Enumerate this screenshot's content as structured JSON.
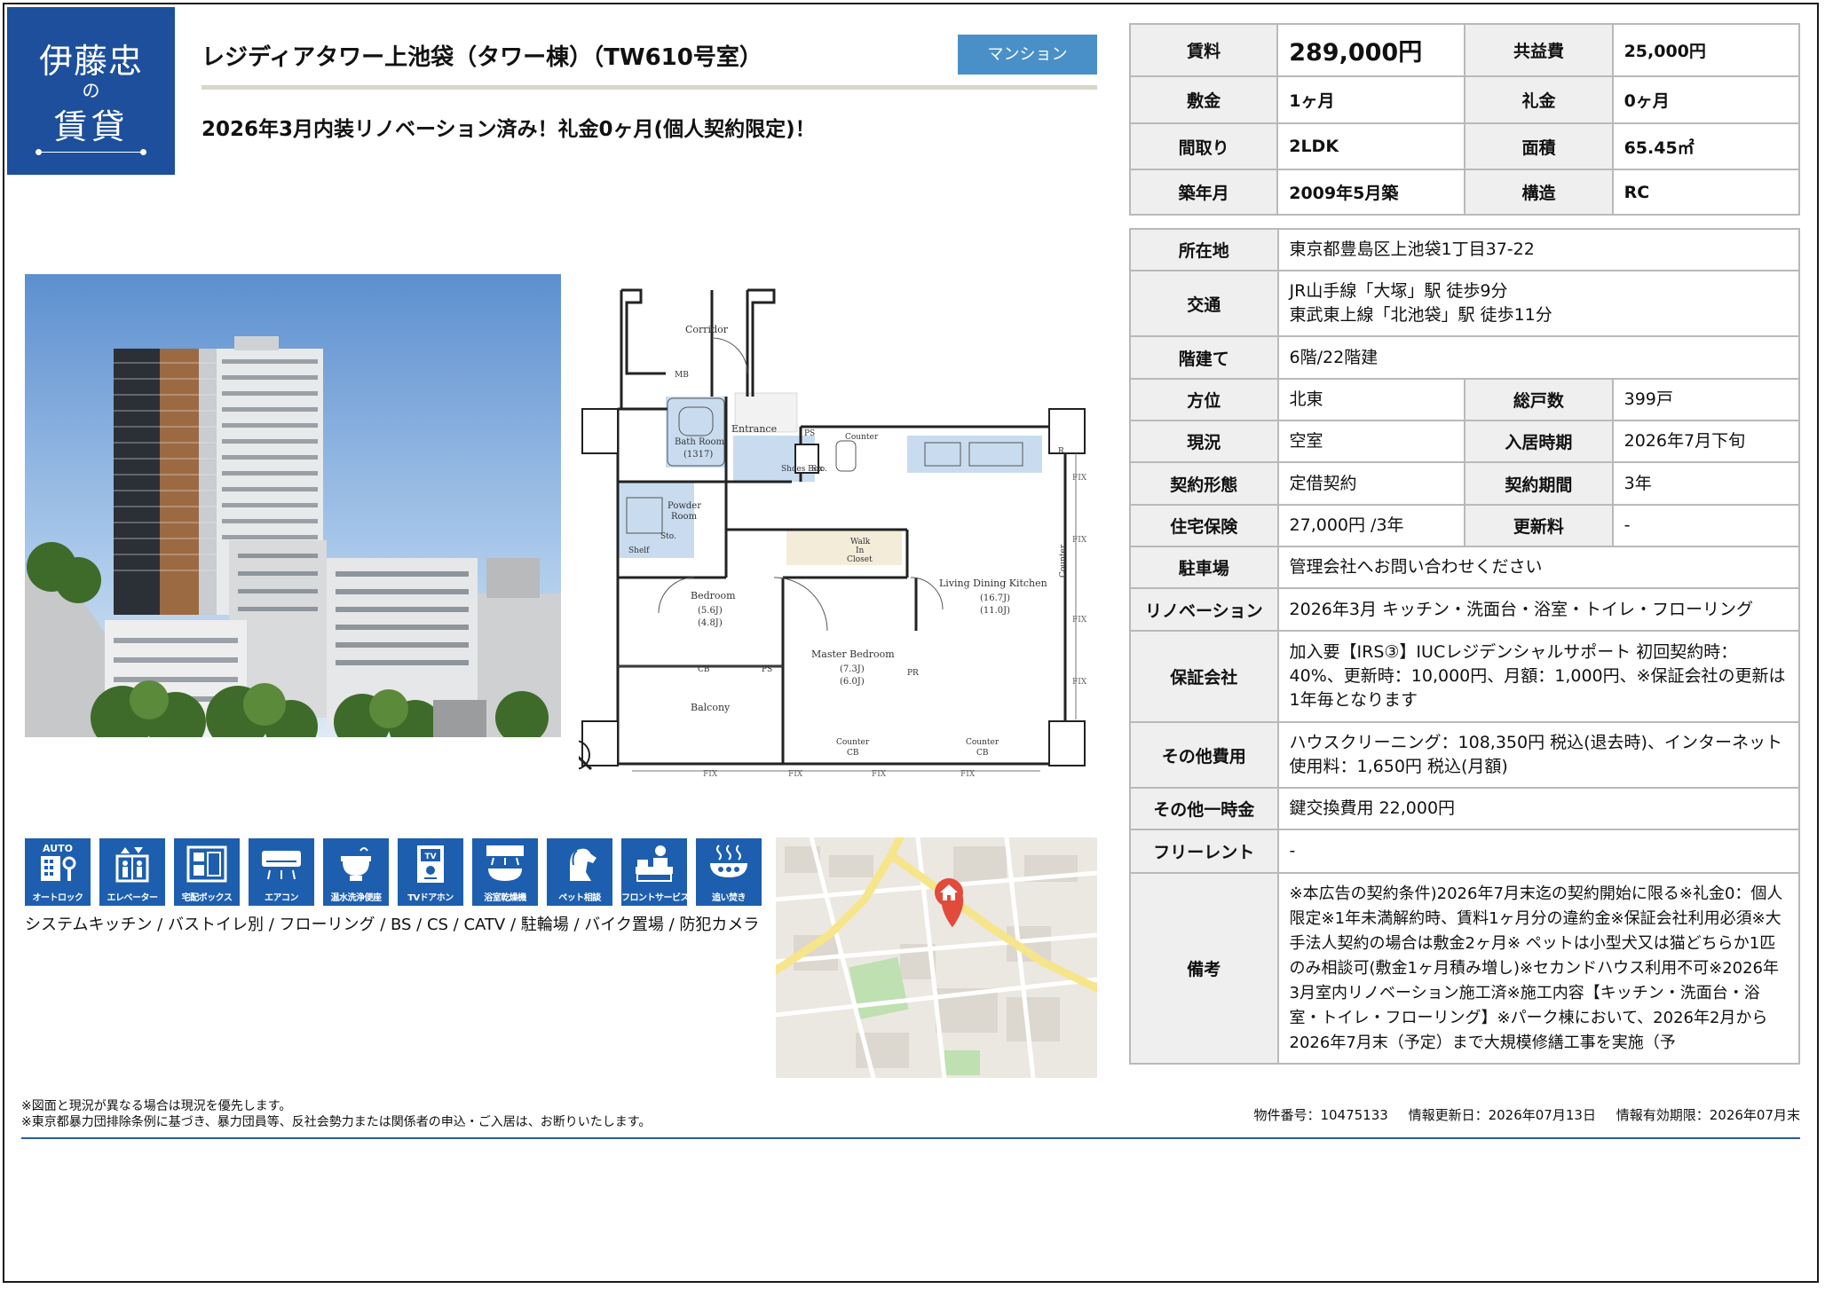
{
  "logo": {
    "line1": "伊藤忠",
    "line2": "の",
    "line3": "賃貸"
  },
  "title": "レジディアタワー上池袋（タワー棟）（TW610号室）",
  "badge": "マンション",
  "subtitle": "2026年3月内装リノベーション済み！礼金0ヶ月(個人契約限定)！",
  "top_table": [
    [
      "賃料",
      "289,000円",
      "共益費",
      "25,000円"
    ],
    [
      "敷金",
      "1ヶ月",
      "礼金",
      "0ヶ月"
    ],
    [
      "間取り",
      "2LDK",
      "面積",
      "65.45㎡"
    ],
    [
      "築年月",
      "2009年5月築",
      "構造",
      "RC"
    ]
  ],
  "details": {
    "address_label": "所在地",
    "address": "東京都豊島区上池袋1丁目37-22",
    "transit_label": "交通",
    "transit_1": "JR山手線「大塚」駅 徒歩9分",
    "transit_2": "東武東上線「北池袋」駅 徒歩11分",
    "floor_label": "階建て",
    "floor": "6階/22階建",
    "direction_label": "方位",
    "direction": "北東",
    "units_label": "総戸数",
    "units": "399戸",
    "status_label": "現況",
    "status": "空室",
    "movein_label": "入居時期",
    "movein": "2026年7月下旬",
    "contract_label": "契約形態",
    "contract": "定借契約",
    "term_label": "契約期間",
    "term": "3年",
    "insurance_label": "住宅保険",
    "insurance": "27,000円 /3年",
    "renewal_label": "更新料",
    "renewal": "-",
    "parking_label": "駐車場",
    "parking": "管理会社へお問い合わせください",
    "renovation_label": "リノベーション",
    "renovation": "2026年3月 キッチン・洗面台・浴室・トイレ・フローリング",
    "guarantor_label": "保証会社",
    "guarantor": "加入要【IRS③】IUCレジデンシャルサポート 初回契約時：40%、更新時：10,000円、月額：1,000円、※保証会社の更新は1年毎となります",
    "other_fee_label": "その他費用",
    "other_fee": "ハウスクリーニング：108,350円 税込(退去時)、インターネット使用料：1,650円 税込(月額)",
    "onetime_label": "その他一時金",
    "onetime": "鍵交換費用 22,000円",
    "freerent_label": "フリーレント",
    "freerent": "-",
    "notes_label": "備考",
    "notes": "※本広告の契約条件)2026年7月末迄の契約開始に限る※礼金0：個人限定※1年未満解約時、賃料1ヶ月分の違約金※保証会社利用必須※大手法人契約の場合は敷金2ヶ月※ ペットは小型犬又は猫どちらか1匹のみ相談可(敷金1ヶ月積み増し)※セカンドハウス利用不可※2026年3月室内リノベーション施工済※施工内容【キッチン・洗面台・浴室・トイレ・フローリング】※パーク棟において、2026年2月から2026年7月末（予定）まで大規模修繕工事を実施（予"
  },
  "floorplan": {
    "corridor": "Corridor",
    "mb": "MB",
    "entrance": "Entrance",
    "bath": "Bath Room",
    "bath_size": "(1317)",
    "counter_top": "Counter",
    "powder": "Powder",
    "powder2": "Room",
    "shelf": "Shelf",
    "sto": "Sto.",
    "shoes": "Shoes Box",
    "ps": "PS",
    "closet1": "Walk",
    "closet2": "In",
    "closet3": "Closet",
    "bedroom": "Bedroom",
    "bedroom_j1": "(5.6J)",
    "bedroom_j2": "(4.8J)",
    "ldk": "Living Dining Kitchen",
    "ldk_j1": "(16.7J)",
    "ldk_j2": "(11.0J)",
    "master": "Master Bedroom",
    "master_j1": "(7.3J)",
    "master_j2": "(6.0J)",
    "balcony": "Balcony",
    "counter_b1": "Counter",
    "counter_b2": "Counter",
    "counter_side": "Counter",
    "cb": "CB",
    "pr": "PR",
    "r": "R",
    "fix": "FIX"
  },
  "icons": [
    {
      "name": "auto-lock-icon",
      "label": "オートロック"
    },
    {
      "name": "elevator-icon",
      "label": "エレベーター"
    },
    {
      "name": "delivery-box-icon",
      "label": "宅配ボックス"
    },
    {
      "name": "air-conditioner-icon",
      "label": "エアコン"
    },
    {
      "name": "washlet-icon",
      "label": "温水洗浄便座"
    },
    {
      "name": "tv-intercom-icon",
      "label": "TVドアホン"
    },
    {
      "name": "bathroom-dryer-icon",
      "label": "浴室乾燥機"
    },
    {
      "name": "pet-icon",
      "label": "ペット相談"
    },
    {
      "name": "front-service-icon",
      "label": "フロントサービス"
    },
    {
      "name": "reheat-bath-icon",
      "label": "追い焚き"
    }
  ],
  "auto_badge": "AUTO",
  "tv_badge": "TV",
  "features": "システムキッチン / バストイレ別 / フローリング / BS / CS / CATV / 駐輪場 / バイク置場 / 防犯カメラ",
  "footer": {
    "note1": "※図面と現況が異なる場合は現況を優先します。",
    "note2": "※東京都暴力団排除条例に基づき、暴力団員等、反社会勢力または関係者の申込・ご入居は、お断りいたします。",
    "property_no": "物件番号：10475133",
    "updated": "情報更新日：2026年07月13日",
    "valid": "情報有効期限：2026年07月末"
  },
  "colors": {
    "brand_blue": "#1d4f9c",
    "icon_blue": "#1d5fae",
    "badge_blue": "#4a90c8",
    "map_pin": "#e24a3b"
  }
}
